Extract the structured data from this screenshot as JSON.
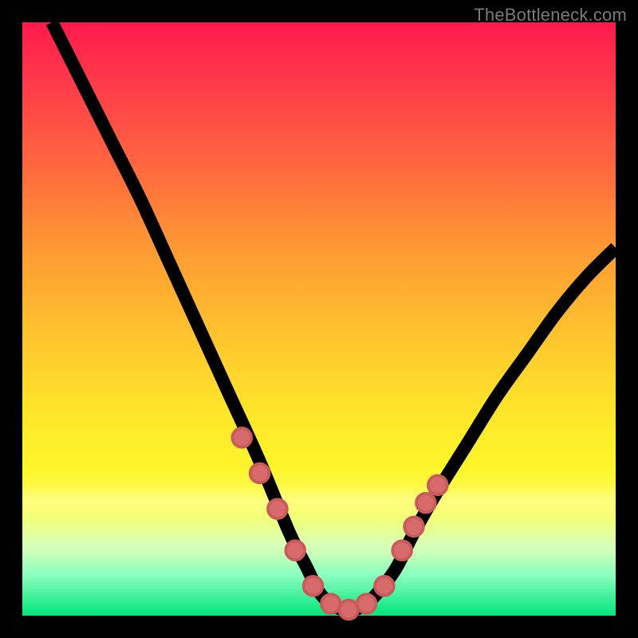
{
  "watermark": {
    "text": "TheBottleneck.com"
  },
  "chart_data": {
    "type": "line",
    "title": "",
    "xlabel": "",
    "ylabel": "",
    "xlim": [
      0,
      100
    ],
    "ylim": [
      0,
      100
    ],
    "grid": false,
    "legend": null,
    "series": [
      {
        "name": "bottleneck-curve",
        "x": [
          5,
          10,
          15,
          20,
          25,
          30,
          35,
          40,
          45,
          48,
          50,
          52,
          54,
          56,
          58,
          60,
          63,
          66,
          70,
          75,
          80,
          85,
          90,
          95,
          100
        ],
        "y": [
          100,
          90,
          80,
          70,
          59,
          48,
          37,
          26,
          14,
          8,
          4,
          2,
          1,
          1,
          2,
          4,
          8,
          14,
          21,
          29,
          37,
          44,
          51,
          57,
          62
        ]
      }
    ],
    "markers": {
      "name": "highlight-dots",
      "color": "#d76a6a",
      "points": [
        {
          "x": 37,
          "y": 30
        },
        {
          "x": 40,
          "y": 24
        },
        {
          "x": 43,
          "y": 18
        },
        {
          "x": 46,
          "y": 11
        },
        {
          "x": 49,
          "y": 5
        },
        {
          "x": 52,
          "y": 2
        },
        {
          "x": 55,
          "y": 1
        },
        {
          "x": 58,
          "y": 2
        },
        {
          "x": 61,
          "y": 5
        },
        {
          "x": 64,
          "y": 11
        },
        {
          "x": 66,
          "y": 15
        },
        {
          "x": 68,
          "y": 19
        },
        {
          "x": 70,
          "y": 22
        }
      ]
    }
  }
}
